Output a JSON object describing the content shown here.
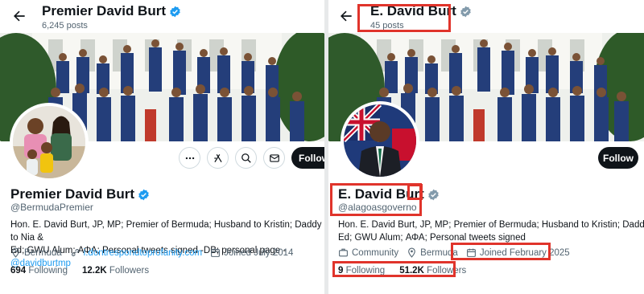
{
  "left": {
    "header_name": "Premier David Burt",
    "header_posts": "6,245 posts",
    "name": "Premier David Burt",
    "handle": "@BermudaPremier",
    "bio_line1": "Hon. E. David Burt, JP, MP; Premier of Bermuda; Husband to Kristin; Daddy to Nia &",
    "bio_line2_text": "Ed; GWU Alum; ΑΦΑ; Personal tweets signed -DB; personal page - ",
    "bio_line2_link": "@davidburtmp",
    "location": "Bermuda",
    "website": "i.dontrespondtoprofanity.com",
    "joined": "Joined July 2014",
    "following_count": "694",
    "following_label": "Following",
    "followers_count": "12.2K",
    "followers_label": "Followers",
    "follow_label": "Follow"
  },
  "right": {
    "header_name": "E. David Burt",
    "header_posts": "45 posts",
    "name": "E. David Burt",
    "handle": "@alagoasgoverno",
    "bio_line1": "Hon. E. David Burt, JP, MP; Premier of Bermuda; Husband to Kristin; Daddy to Nia &",
    "bio_line2": "Ed; GWU Alum; ΑΦΑ; Personal tweets signed",
    "category": "Community",
    "location": "Bermuda",
    "joined": "Joined February 2025",
    "following_count": "9",
    "following_label": "Following",
    "followers_count": "51.2K",
    "followers_label": "Followers",
    "follow_label": "Follow"
  },
  "colors": {
    "verified_blue": "#1d9bf0",
    "verified_gray": "#829aab",
    "highlight_red": "#e0342b",
    "follow_bg": "#0f1419"
  },
  "icons": {
    "back": "arrow-left-icon",
    "more": "more-dots-icon",
    "grok": "grok-icon",
    "search": "search-icon",
    "message": "envelope-icon",
    "location": "location-pin-icon",
    "link": "link-icon",
    "calendar": "calendar-icon",
    "community": "briefcase-icon"
  }
}
